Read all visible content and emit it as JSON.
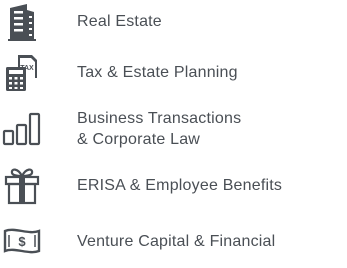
{
  "colors": {
    "icon": "#4a4f55",
    "text": "#4a4f55",
    "background": "#ffffff"
  },
  "practice_areas": [
    {
      "label": "Real Estate",
      "icon": "building-icon"
    },
    {
      "label": "Tax & Estate Planning",
      "icon": "tax-calculator-icon",
      "icon_text": "TAX"
    },
    {
      "label_lines": [
        "Business Transactions",
        "& Corporate Law"
      ],
      "icon": "bar-chart-icon"
    },
    {
      "label": "ERISA & Employee Benefits",
      "icon": "gift-icon"
    },
    {
      "label": "Venture Capital & Financial",
      "icon": "money-bill-icon"
    }
  ]
}
